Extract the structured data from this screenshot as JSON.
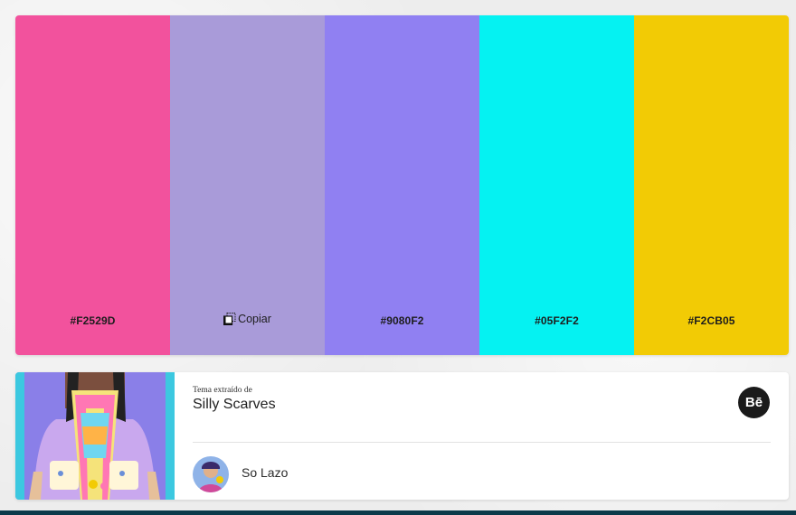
{
  "palette": {
    "swatches": [
      {
        "color": "#F2529D",
        "label": "#F2529D"
      },
      {
        "color": "#A99BD9",
        "label": ""
      },
      {
        "color": "#9080F2",
        "label": "#9080F2"
      },
      {
        "color": "#05F2F2",
        "label": "#05F2F2"
      },
      {
        "color": "#F2CB05",
        "label": "#F2CB05"
      }
    ],
    "copy_label": "Copiar"
  },
  "card": {
    "subtitle": "Tema extraído de",
    "title": "Silly Scarves",
    "behance_label": "Bē",
    "author": "So Lazo"
  }
}
